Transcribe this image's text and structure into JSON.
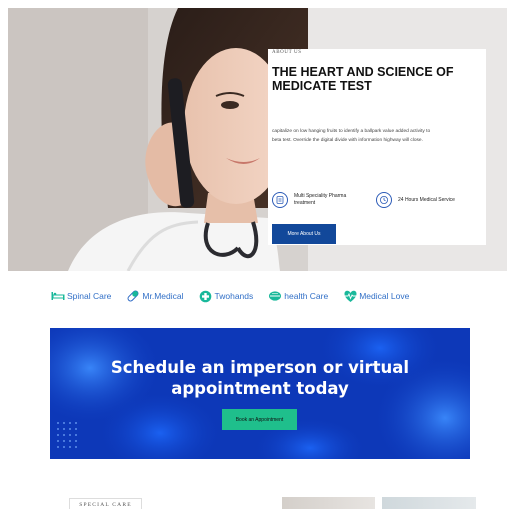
{
  "about": {
    "eyebrow": "ABOUT US",
    "title": "THE HEART AND SCIENCE OF MEDICATE TEST",
    "body": "capitalize on low hanging fruits to identify a ballpark value added activity to beta test. Override the digital divide with information highway will close.",
    "features": [
      {
        "label": "Multi Speciality Pharma treatment",
        "icon": "pharmacy-icon"
      },
      {
        "label": "24 Hours Medical Service",
        "icon": "clock-icon"
      }
    ],
    "button_label": "More About Us"
  },
  "services": [
    {
      "label": "Spinal Care",
      "icon": "bed-icon"
    },
    {
      "label": "Mr.Medical",
      "icon": "pill-icon"
    },
    {
      "label": "Twohands",
      "icon": "medical-cross-icon"
    },
    {
      "label": "health Care",
      "icon": "capsule-icon"
    },
    {
      "label": "Medical Love",
      "icon": "heartbeat-icon"
    }
  ],
  "cta": {
    "title": "Schedule an imperson or virtual appointment today",
    "button_label": "Book an Appointment"
  },
  "special": {
    "tag": "SPECIAL CARE"
  },
  "colors": {
    "primary_blue": "#12489a",
    "accent_teal": "#1fbf8c",
    "service_blue": "#3270c7",
    "banner_blue": "#0f3ec4"
  }
}
